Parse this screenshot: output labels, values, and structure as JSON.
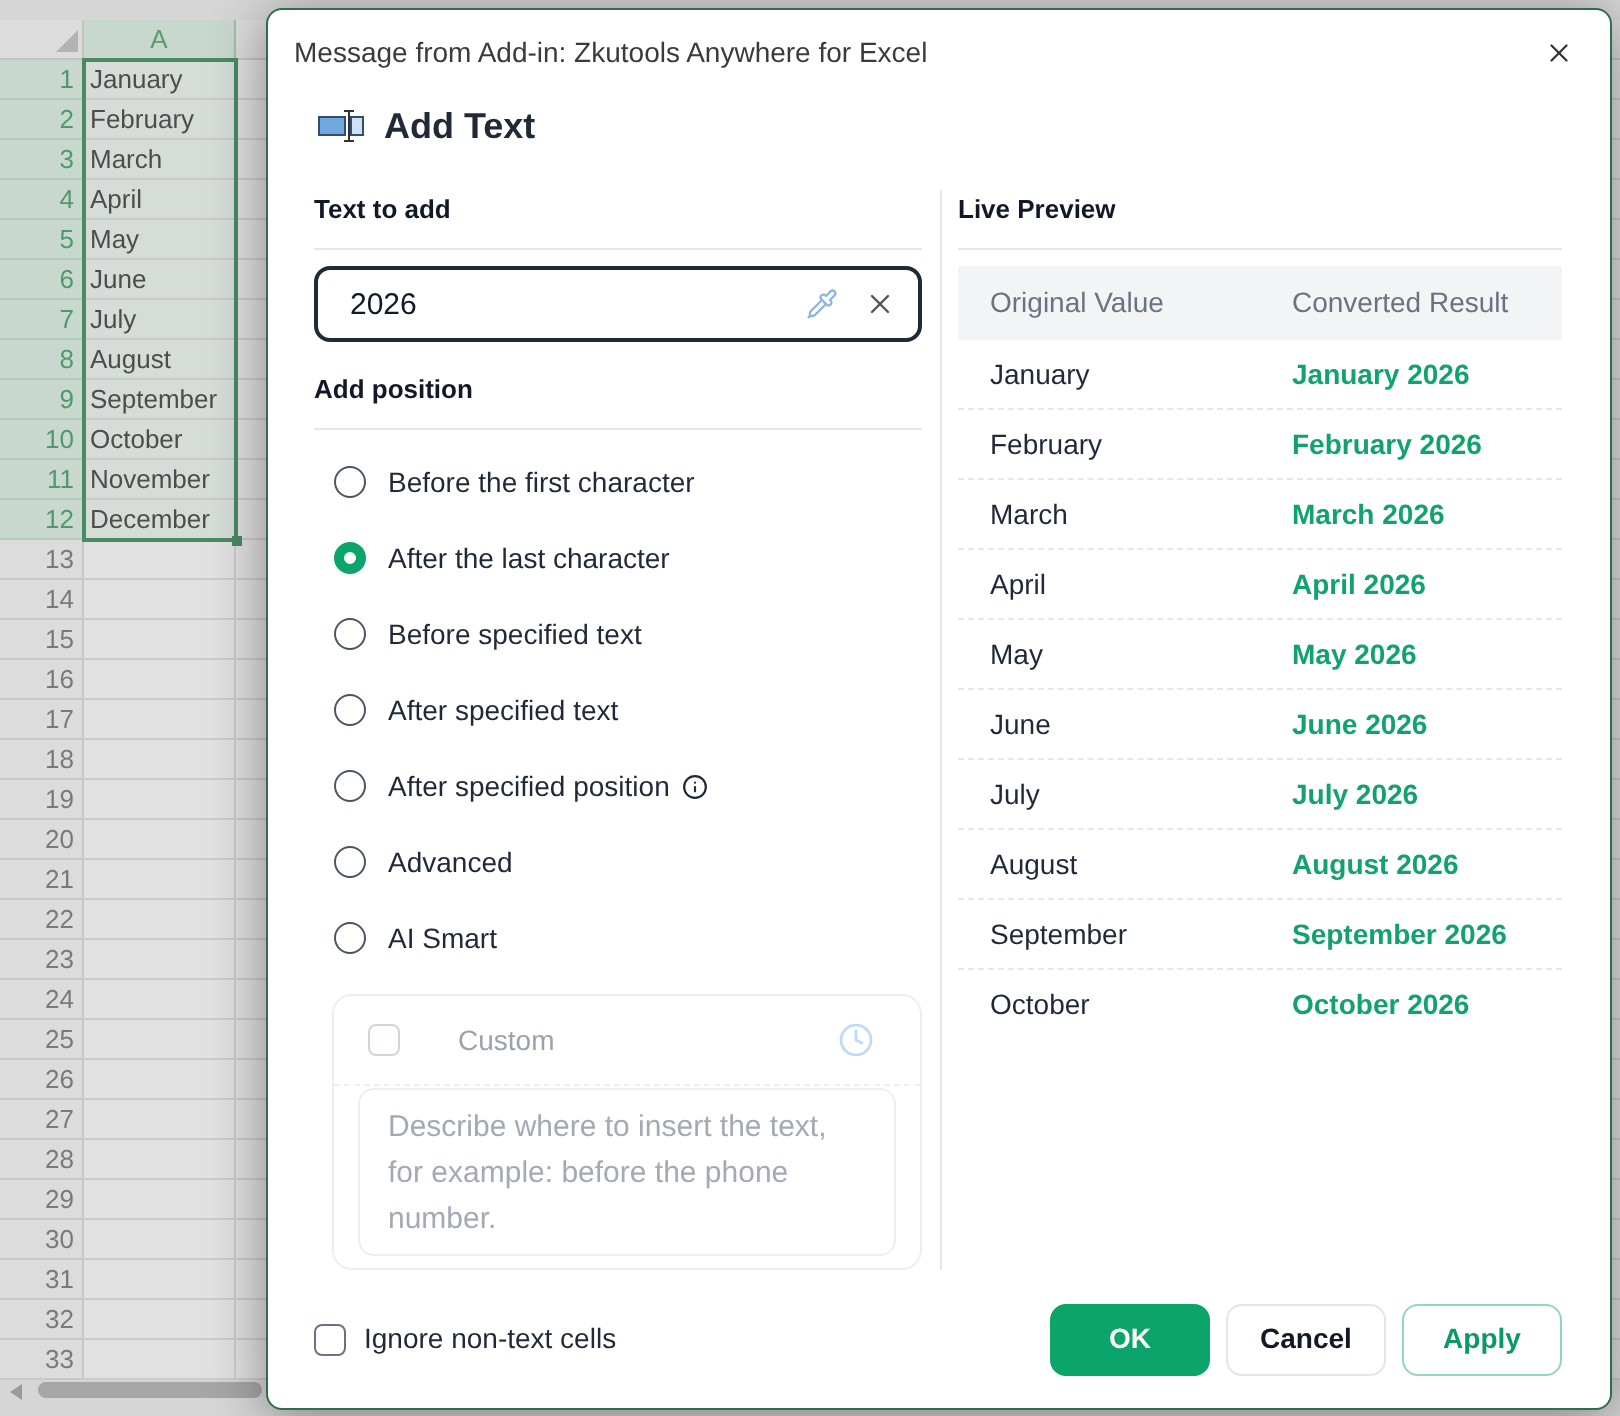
{
  "spreadsheet": {
    "columns": [
      {
        "label": "A",
        "selected": true
      }
    ],
    "rows": [
      {
        "number": "1",
        "cell": "January",
        "selected": true
      },
      {
        "number": "2",
        "cell": "February",
        "selected": true
      },
      {
        "number": "3",
        "cell": "March",
        "selected": true
      },
      {
        "number": "4",
        "cell": "April",
        "selected": true
      },
      {
        "number": "5",
        "cell": "May",
        "selected": true
      },
      {
        "number": "6",
        "cell": "June",
        "selected": true
      },
      {
        "number": "7",
        "cell": "July",
        "selected": true
      },
      {
        "number": "8",
        "cell": "August",
        "selected": true
      },
      {
        "number": "9",
        "cell": "September",
        "selected": true
      },
      {
        "number": "10",
        "cell": "October",
        "selected": true
      },
      {
        "number": "11",
        "cell": "November",
        "selected": true
      },
      {
        "number": "12",
        "cell": "December",
        "selected": true
      },
      {
        "number": "13",
        "selected": false
      },
      {
        "number": "14",
        "selected": false
      },
      {
        "number": "15",
        "selected": false
      },
      {
        "number": "16",
        "selected": false
      },
      {
        "number": "17",
        "selected": false
      },
      {
        "number": "18",
        "selected": false
      },
      {
        "number": "19",
        "selected": false
      },
      {
        "number": "20",
        "selected": false
      },
      {
        "number": "21",
        "selected": false
      },
      {
        "number": "22",
        "selected": false
      },
      {
        "number": "23",
        "selected": false
      },
      {
        "number": "24",
        "selected": false
      },
      {
        "number": "25",
        "selected": false
      },
      {
        "number": "26",
        "selected": false
      },
      {
        "number": "27",
        "selected": false
      },
      {
        "number": "28",
        "selected": false
      },
      {
        "number": "29",
        "selected": false
      },
      {
        "number": "30",
        "selected": false
      },
      {
        "number": "31",
        "selected": false
      },
      {
        "number": "32",
        "selected": false
      },
      {
        "number": "33",
        "selected": false
      }
    ]
  },
  "dialog": {
    "title": "Message from Add-in: Zkutools Anywhere for Excel",
    "heading": "Add Text",
    "text_to_add": {
      "label": "Text to add",
      "value": "2026"
    },
    "add_position": {
      "label": "Add position",
      "options": [
        {
          "label": "Before the first character",
          "selected": false,
          "info_icon": false
        },
        {
          "label": "After the last character",
          "selected": true,
          "info_icon": false
        },
        {
          "label": "Before specified text",
          "selected": false,
          "info_icon": false
        },
        {
          "label": "After specified text",
          "selected": false,
          "info_icon": false
        },
        {
          "label": "After specified position",
          "selected": false,
          "info_icon": true
        },
        {
          "label": "Advanced",
          "selected": false,
          "info_icon": false
        },
        {
          "label": "AI Smart",
          "selected": false,
          "info_icon": false
        }
      ]
    },
    "custom": {
      "label": "Custom",
      "checked": false,
      "disabled": true,
      "placeholder": "Describe where to insert the text, for example: before the phone number."
    },
    "live_preview": {
      "title": "Live Preview",
      "columns": [
        "Original Value",
        "Converted Result"
      ],
      "rows": [
        {
          "original": "January",
          "converted": "January 2026"
        },
        {
          "original": "February",
          "converted": "February 2026"
        },
        {
          "original": "March",
          "converted": "March 2026"
        },
        {
          "original": "April",
          "converted": "April 2026"
        },
        {
          "original": "May",
          "converted": "May 2026"
        },
        {
          "original": "June",
          "converted": "June 2026"
        },
        {
          "original": "July",
          "converted": "July 2026"
        },
        {
          "original": "August",
          "converted": "August 2026"
        },
        {
          "original": "September",
          "converted": "September 2026"
        },
        {
          "original": "October",
          "converted": "October 2026"
        }
      ]
    },
    "ignore_non_text_cells": {
      "label": "Ignore non-text cells",
      "checked": false
    },
    "buttons": [
      {
        "label": "OK",
        "kind": "primary"
      },
      {
        "label": "Cancel",
        "kind": "secondary"
      },
      {
        "label": "Apply",
        "kind": "outline"
      }
    ]
  }
}
